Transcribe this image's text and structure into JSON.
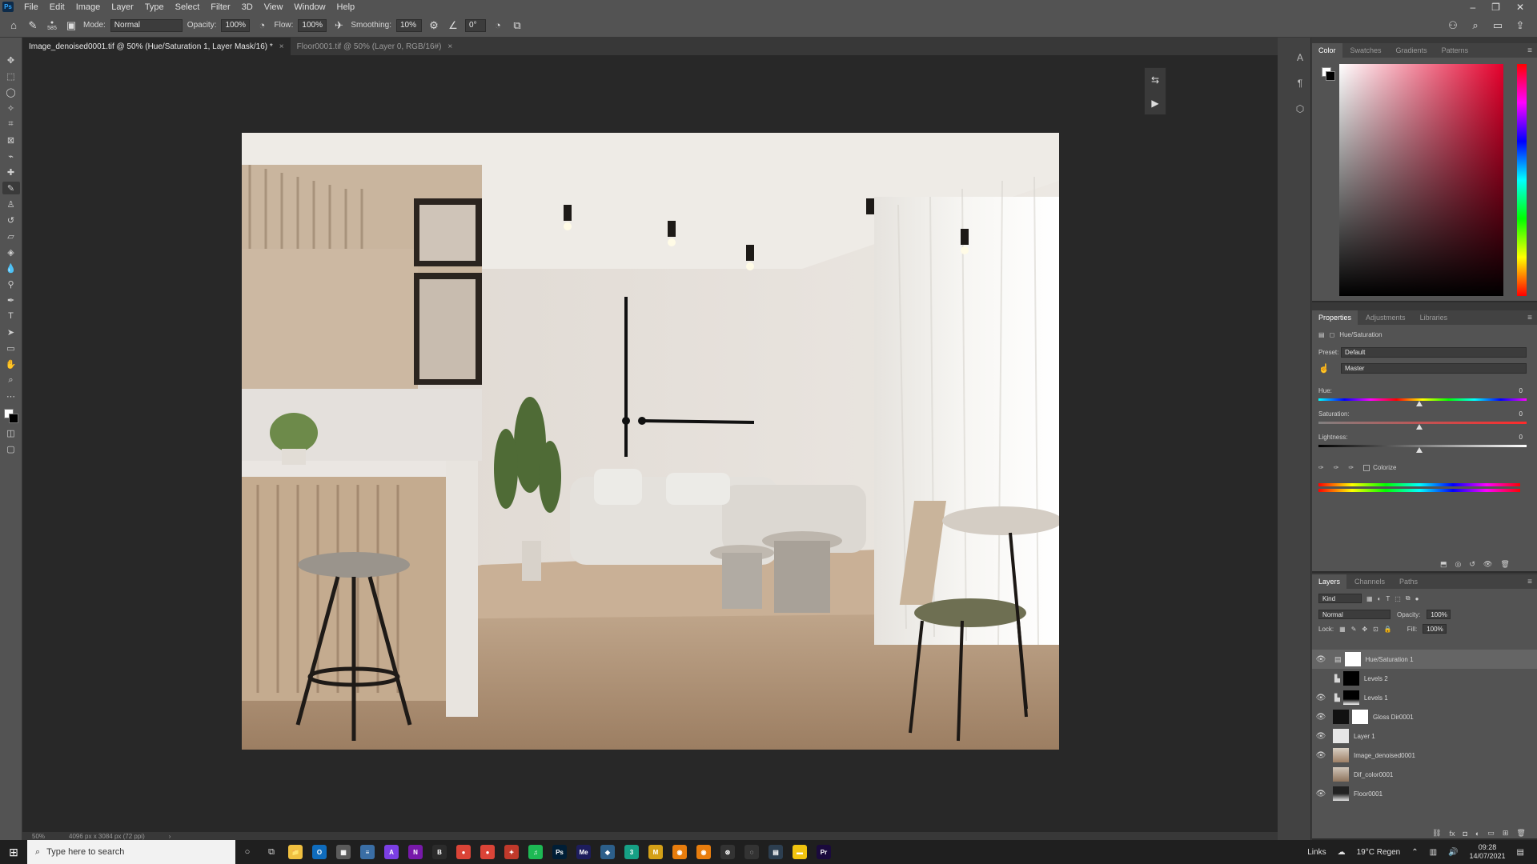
{
  "menubar": {
    "logo": "Ps",
    "items": [
      "File",
      "Edit",
      "Image",
      "Layer",
      "Type",
      "Select",
      "Filter",
      "3D",
      "View",
      "Window",
      "Help"
    ],
    "window_controls": [
      "–",
      "❐",
      "✕"
    ]
  },
  "options": {
    "brush_size": "585",
    "mode_label": "Mode:",
    "mode_value": "Normal",
    "opacity_label": "Opacity:",
    "opacity_value": "100%",
    "flow_label": "Flow:",
    "flow_value": "100%",
    "smoothing_label": "Smoothing:",
    "smoothing_value": "10%",
    "angle_value": "0°"
  },
  "tabs": [
    {
      "label": "Image_denoised0001.tif @ 50% (Hue/Saturation 1, Layer Mask/16) *",
      "close": "×"
    },
    {
      "label": "Floor0001.tif @ 50% (Layer 0, RGB/16#)",
      "close": "×"
    }
  ],
  "statusbar": {
    "zoom": "50%",
    "doc_info": "4096 px x 3084 px (72 ppi)",
    "arrow": "›"
  },
  "color_panel": {
    "tabs": [
      "Color",
      "Swatches",
      "Gradients",
      "Patterns"
    ],
    "menu": "≡"
  },
  "properties_panel": {
    "tabs": [
      "Properties",
      "Adjustments",
      "Libraries"
    ],
    "title": "Hue/Saturation",
    "preset_label": "Preset:",
    "preset_value": "Default",
    "channel_value": "Master",
    "hue_label": "Hue:",
    "hue_value": "0",
    "saturation_label": "Saturation:",
    "saturation_value": "0",
    "lightness_label": "Lightness:",
    "lightness_value": "0",
    "colorize_label": "Colorize",
    "menu": "≡"
  },
  "layers_panel": {
    "tabs": [
      "Layers",
      "Channels",
      "Paths"
    ],
    "kind_label": "Kind",
    "blend_mode": "Normal",
    "opacity_label": "Opacity:",
    "opacity_value": "100%",
    "lock_label": "Lock:",
    "fill_label": "Fill:",
    "fill_value": "100%",
    "menu": "≡",
    "layers": [
      {
        "name": "Hue/Saturation 1",
        "visible": true,
        "selected": true
      },
      {
        "name": "Levels 2",
        "visible": false,
        "selected": false
      },
      {
        "name": "Levels 1",
        "visible": true,
        "selected": false
      },
      {
        "name": "Gloss Dir0001",
        "visible": true,
        "selected": false
      },
      {
        "name": "Layer 1",
        "visible": true,
        "selected": false
      },
      {
        "name": "Image_denoised0001",
        "visible": true,
        "selected": false
      },
      {
        "name": "Dif_color0001",
        "visible": false,
        "selected": false
      },
      {
        "name": "Floor0001",
        "visible": true,
        "selected": false
      }
    ]
  },
  "taskbar": {
    "search_placeholder": "Type here to search",
    "links_label": "Links",
    "weather": "19°C  Regen",
    "time": "09:28",
    "date": "14/07/2021",
    "apps": [
      {
        "name": "file-explorer",
        "label": "📁",
        "color": "#f0c040"
      },
      {
        "name": "outlook",
        "label": "O",
        "color": "#0f6cbd"
      },
      {
        "name": "calculator",
        "label": "▦",
        "color": "#5b5b5b"
      },
      {
        "name": "app-4",
        "label": "≡",
        "color": "#3a6ea5"
      },
      {
        "name": "affinity",
        "label": "A",
        "color": "#7b3fe4"
      },
      {
        "name": "onenote",
        "label": "N",
        "color": "#7719aa"
      },
      {
        "name": "app-7",
        "label": "B",
        "color": "#2b2b2b"
      },
      {
        "name": "chrome",
        "label": "●",
        "color": "#db4437"
      },
      {
        "name": "chrome-2",
        "label": "●",
        "color": "#db4437"
      },
      {
        "name": "app-10",
        "label": "✦",
        "color": "#c0392b"
      },
      {
        "name": "spotify",
        "label": "♫",
        "color": "#1db954"
      },
      {
        "name": "photoshop",
        "label": "Ps",
        "color": "#001e36"
      },
      {
        "name": "media-encoder",
        "label": "Me",
        "color": "#1d1d5c"
      },
      {
        "name": "app-14",
        "label": "◆",
        "color": "#2c5f8a"
      },
      {
        "name": "app-15",
        "label": "3",
        "color": "#16a085"
      },
      {
        "name": "app-16",
        "label": "M",
        "color": "#d4a017"
      },
      {
        "name": "blender",
        "label": "◉",
        "color": "#e87d0d"
      },
      {
        "name": "blender-2",
        "label": "◉",
        "color": "#e87d0d"
      },
      {
        "name": "app-19",
        "label": "⊛",
        "color": "#333333"
      },
      {
        "name": "app-20",
        "label": "◌",
        "color": "#333333"
      },
      {
        "name": "app-21",
        "label": "▤",
        "color": "#2c3e50"
      },
      {
        "name": "sticky-notes",
        "label": "▬",
        "color": "#f1c40f"
      },
      {
        "name": "premiere",
        "label": "Pr",
        "color": "#1a0a3c"
      }
    ]
  },
  "colors": {
    "hue_gradient": "#e5002c",
    "accent": "#31a8ff"
  }
}
